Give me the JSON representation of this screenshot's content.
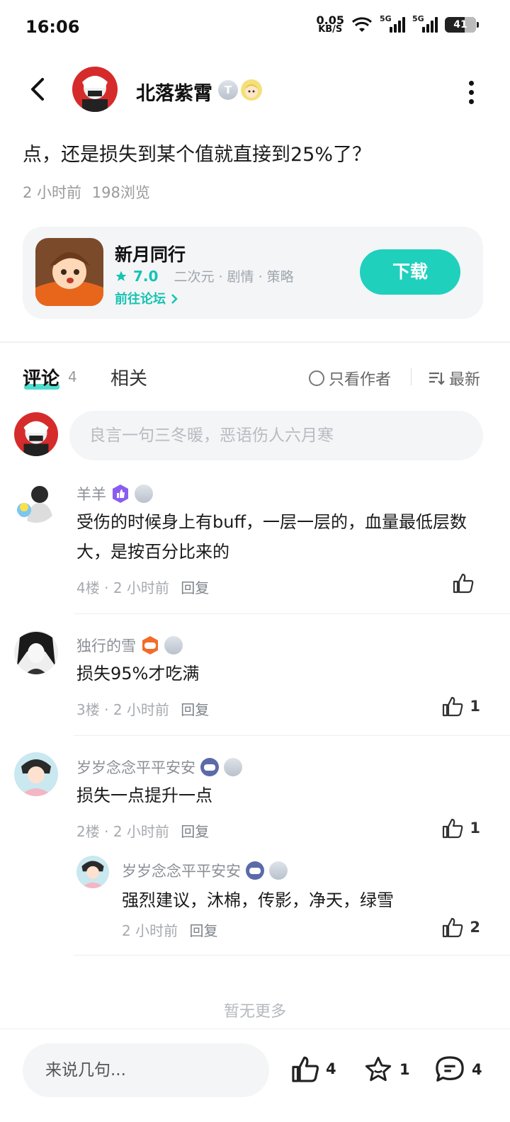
{
  "status_bar": {
    "time": "16:06",
    "net_speed": "0.05",
    "net_unit": "KB/S",
    "signal1_label": "5G",
    "signal2_label": "5G",
    "battery": "41"
  },
  "header": {
    "author_name": "北落紫霄",
    "level_badge": "T"
  },
  "post": {
    "text": "点，还是损失到某个值就直接到25%了？",
    "time": "2 小时前",
    "views": "198浏览"
  },
  "app_card": {
    "name": "新月同行",
    "rating": "7.0",
    "tags": "二次元 · 剧情 · 策略",
    "forum_link": "前往论坛",
    "download_label": "下载"
  },
  "tabs": {
    "comments_label": "评论",
    "comments_count": "4",
    "related_label": "相关",
    "author_only_label": "只看作者",
    "sort_label": "最新"
  },
  "comment_input": {
    "placeholder": "良言一句三冬暖，恶语伤人六月寒"
  },
  "comments": [
    {
      "name": "羊羊",
      "body": "受伤的时候身上有buff，一层一层的，血量最低层数大，是按百分比来的",
      "floor": "4楼",
      "time": "2 小时前",
      "reply": "回复",
      "likes": ""
    },
    {
      "name": "独行的雪",
      "body": "损失95%才吃满",
      "floor": "3楼",
      "time": "2 小时前",
      "reply": "回复",
      "likes": "1"
    },
    {
      "name": "岁岁念念平平安安",
      "body": "损失一点提升一点",
      "floor": "2楼",
      "time": "2 小时前",
      "reply": "回复",
      "likes": "1"
    }
  ],
  "sub_comment": {
    "name": "岁岁念念平平安安",
    "body": "强烈建议，沐棉，传影，净天，绿雪",
    "time": "2 小时前",
    "reply": "回复",
    "likes": "2"
  },
  "no_more": "暂无更多",
  "bottom_bar": {
    "input_placeholder": "来说几句...",
    "likes": "4",
    "favorites": "1",
    "comments": "4"
  },
  "colors": {
    "accent": "#1fd0bd",
    "text_primary": "#1a1a1a",
    "text_secondary": "#9a9a9a"
  }
}
